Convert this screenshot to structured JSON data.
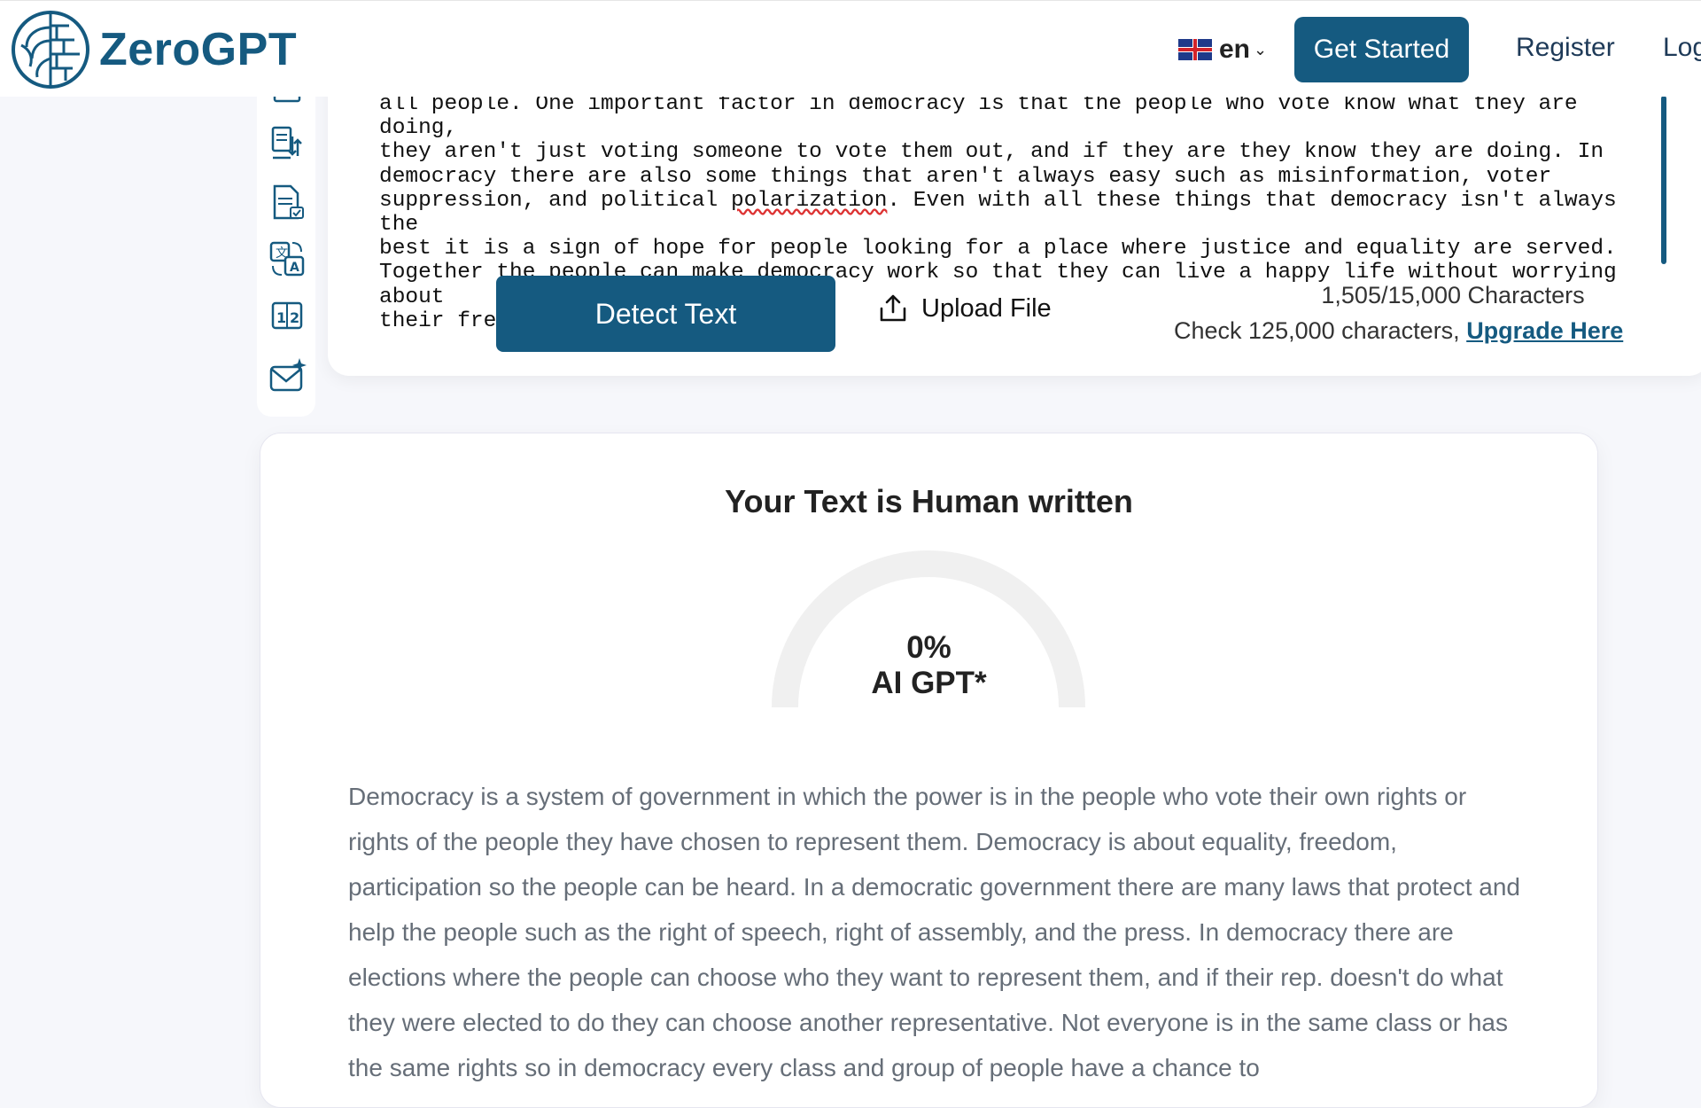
{
  "header": {
    "brand": "ZeroGPT",
    "language": "en",
    "get_started": "Get Started",
    "register": "Register",
    "login": "Log"
  },
  "sidebar": {
    "icons": [
      "text-list-icon",
      "document-transfer-icon",
      "document-check-icon",
      "translate-icon",
      "counter-icon",
      "email-sparkle-icon"
    ]
  },
  "editor": {
    "text_before": "all people. One important factor in democracy is that the people who vote know what they are doing,\nthey aren't just voting someone to vote them out, and if they are they know they are doing. In\ndemocracy there are also some things that aren't always easy such as misinformation, voter\nsuppression, and political ",
    "text_underlined": "polarization",
    "text_after": ". Even with all these things that democracy isn't always the\nbest it is a sign of hope for people looking for a place where justice and equality are served.\nTogether the people can make democracy work so that they can live a happy life without worrying about\ntheir freedom or equality.",
    "detect_button": "Detect Text",
    "upload_label": "Upload File",
    "char_count": "1,505/15,000 Characters",
    "upgrade_prefix": "Check 125,000 characters, ",
    "upgrade_link": "Upgrade Here"
  },
  "result": {
    "title": "Your Text is Human written",
    "percent": "0%",
    "percent_value": 0,
    "gauge_label": "AI GPT*",
    "body": "Democracy is a system of government in which the power is in the people who vote their own rights or rights of the people they have chosen to represent them. Democracy is about equality, freedom, participation so the people can be heard. In a democratic government there are many laws that protect and help the people such as the right of speech, right of assembly, and the press. In democracy there are elections where the people can choose who they want to represent them, and if their rep. doesn't do what they were elected to do they can choose another representative. Not everyone is in the same class or has the same rights so in democracy every class and group of people have a chance to"
  },
  "colors": {
    "brand": "#155a80",
    "gauge_track": "#f0f0f0",
    "body_text": "#666e78"
  }
}
